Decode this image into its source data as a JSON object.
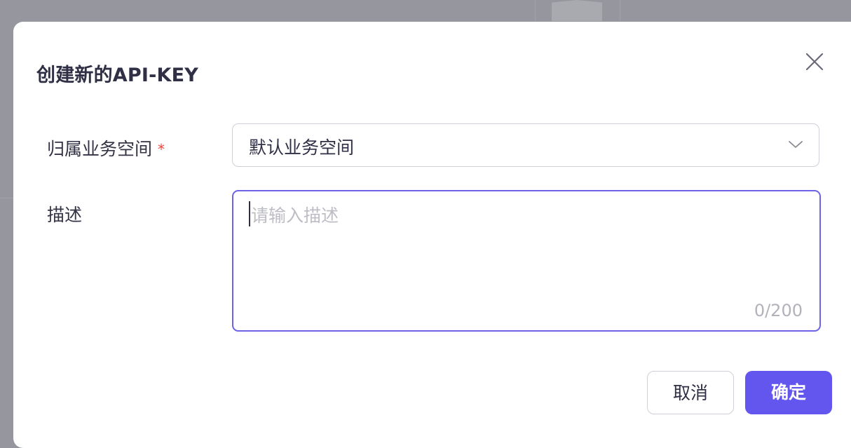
{
  "dialog": {
    "title": "创建新的API-KEY",
    "close_icon": "close-icon"
  },
  "form": {
    "workspace": {
      "label": "归属业务空间",
      "required_mark": "*",
      "selected_value": "默认业务空间",
      "chevron_icon": "chevron-down-icon"
    },
    "description": {
      "label": "描述",
      "placeholder": "请输入描述",
      "value": "",
      "char_count": "0/200"
    }
  },
  "actions": {
    "cancel_label": "取消",
    "confirm_label": "确定"
  },
  "colors": {
    "accent": "#6256ef",
    "focus_border": "#6b63e8",
    "required": "#f0443c",
    "backdrop": "#96969e"
  }
}
